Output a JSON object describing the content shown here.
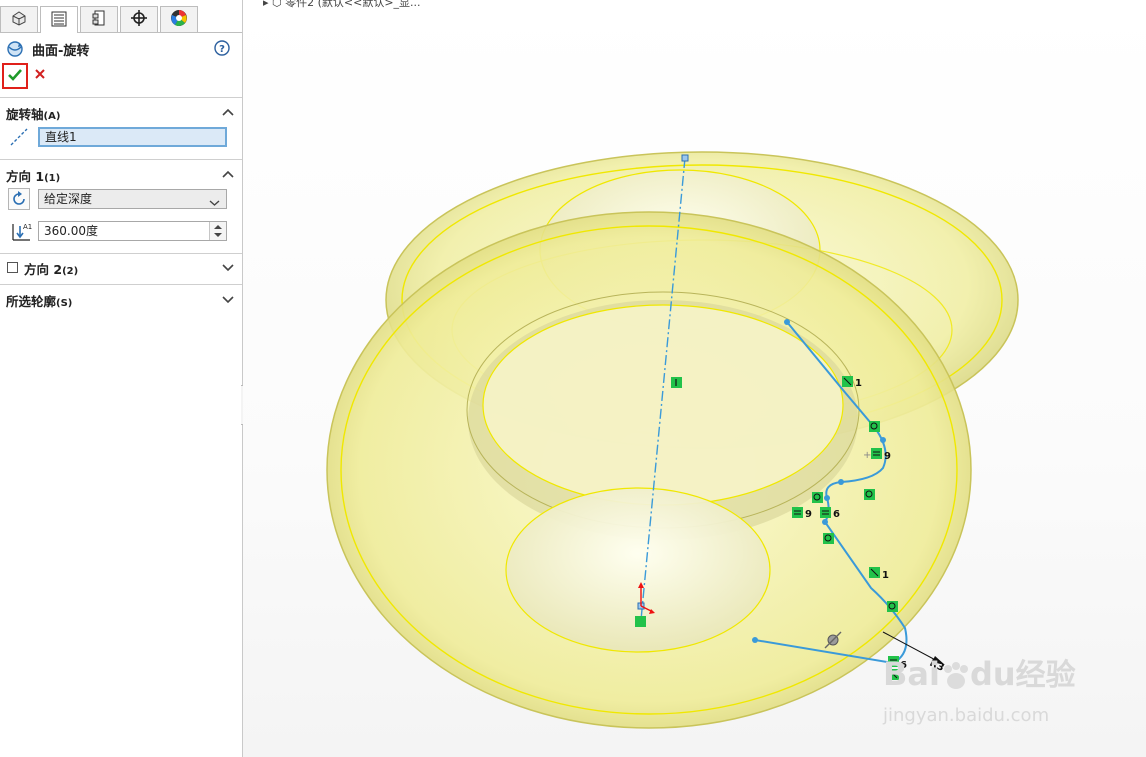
{
  "property_manager": {
    "tabs": [
      "feature-manager-icon",
      "property-manager-icon",
      "configuration-manager-icon",
      "dimxpert-icon",
      "display-manager-icon"
    ],
    "feature_title": "曲面-旋转",
    "ok_label": "✔",
    "cancel_label": "✕",
    "groups": {
      "axis": {
        "title": "旋转轴",
        "hotkey": "(A)",
        "value": "直线1"
      },
      "direction1": {
        "title": "方向 1",
        "hotkey": "(1)",
        "end_condition": "给定深度",
        "angle": "360.00度"
      },
      "direction2": {
        "title": "方向 2",
        "hotkey": "(2)"
      },
      "contours": {
        "title": "所选轮廓",
        "hotkey": "(S)"
      }
    }
  },
  "viewport": {
    "tree_text": "零件2 (默认<<默认>_显...",
    "sketch_relations": [
      "1",
      "9",
      "9",
      "6",
      "1",
      "6"
    ],
    "dimension": "R3",
    "watermark": {
      "brand": "Bai",
      "brand2": "du",
      "suffix": "经验",
      "url": "jingyan.baidu.com"
    }
  },
  "colors": {
    "accent": "#3a9ad9",
    "surface": "#f3f1a0",
    "edge": "#f0e800",
    "ok": "#1f9a2a",
    "cancel": "#d22020",
    "highlight": "#e0201a"
  }
}
